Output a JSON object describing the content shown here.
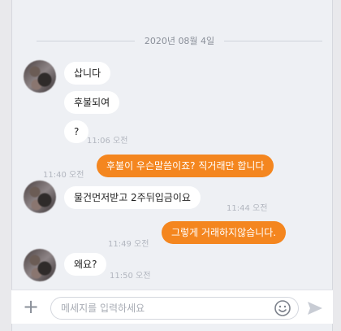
{
  "date_separator": "2020년 08월 4일",
  "messages": [
    {
      "text": "삽니다"
    },
    {
      "text": "후불되여"
    },
    {
      "text": "?",
      "time": "11:06 오전"
    },
    {
      "text": "후불이 우슨말씀이죠? 직거래만 합니다",
      "time": "11:40 오전"
    },
    {
      "text": "물건먼저받고 2주뒤입금이요",
      "time": "11:44 오전"
    },
    {
      "text": "그렇게 거래하지않습니다.",
      "time": "11:49 오전"
    },
    {
      "text": "왜요?",
      "time": "11:50 오전"
    }
  ],
  "composer": {
    "placeholder": "메세지를 입력하세요",
    "add_icon": "plus-icon",
    "emoji_icon": "emoji-icon",
    "send_icon": "send-icon"
  },
  "colors": {
    "outgoing_bubble": "#f4861f",
    "incoming_bubble": "#ffffff",
    "background": "#eef0f4"
  }
}
